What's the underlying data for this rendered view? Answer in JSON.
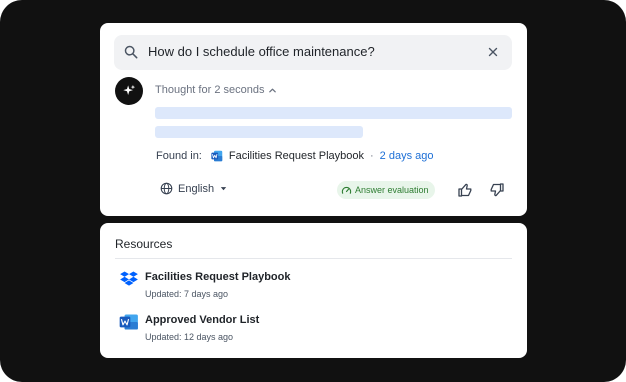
{
  "search": {
    "query": "How do I schedule office maintenance?",
    "icon": "search-icon",
    "clear_icon": "close-icon"
  },
  "answer": {
    "thought_label": "Thought for 2 seconds",
    "found_in_label": "Found in:",
    "source_doc": "Facilities Request Playbook",
    "separator": "·",
    "source_time": "2 days ago",
    "language": "English",
    "evaluation_label": "Answer evaluation"
  },
  "resources": {
    "title": "Resources",
    "items": [
      {
        "name": "Facilities Request Playbook",
        "updated": "Updated: 7 days ago",
        "icon": "dropbox-icon"
      },
      {
        "name": "Approved Vendor List",
        "updated": "Updated: 12 days ago",
        "icon": "word-doc-icon"
      }
    ]
  },
  "colors": {
    "frame_background": "#111111",
    "skeleton": "#dde8fb",
    "link_blue": "#1d6fd6",
    "badge_green": "#2e7d32",
    "badge_bg": "#e8f5ea",
    "dropbox_blue": "#0061fe",
    "word_blue": "#185abd"
  }
}
